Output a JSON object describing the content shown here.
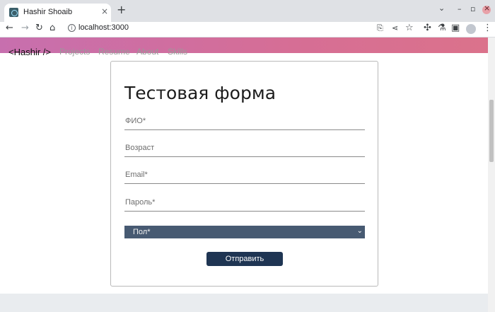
{
  "browser": {
    "tab_title": "Hashir Shoaib",
    "tab_close": "×",
    "new_tab": "+",
    "url": "localhost:3000",
    "window_controls": {
      "dropdown": "⌄",
      "minimize": "–",
      "restore": "▫"
    }
  },
  "navbar": {
    "brand": "<Hashir />",
    "links": [
      "Projects",
      "Resume",
      "About",
      "Skills"
    ]
  },
  "form": {
    "title": "Тестовая форма",
    "fields": [
      {
        "label": "ФИО*"
      },
      {
        "label": "Возраст"
      },
      {
        "label": "Email*"
      },
      {
        "label": "Пароль*"
      }
    ],
    "gender_select": {
      "label": "Пол*",
      "chevron": "⌄"
    },
    "submit_label": "Отправить"
  },
  "colors": {
    "navbar_gradient_start": "#c76fae",
    "navbar_gradient_end": "#db728b",
    "select_bg": "#475a72",
    "submit_bg": "#1f3553",
    "footer_bg": "#e9ecef"
  },
  "icons": {
    "back": "back-arrow-icon",
    "forward": "forward-arrow-icon",
    "reload": "reload-icon",
    "home": "home-icon",
    "info": "info-icon",
    "install": "install-app-icon",
    "share": "share-icon",
    "bookmark": "star-icon",
    "extensions": "puzzle-icon",
    "lab": "flask-icon",
    "sidepanel": "side-panel-icon",
    "profile": "profile-avatar-icon",
    "menu": "kebab-menu-icon"
  }
}
